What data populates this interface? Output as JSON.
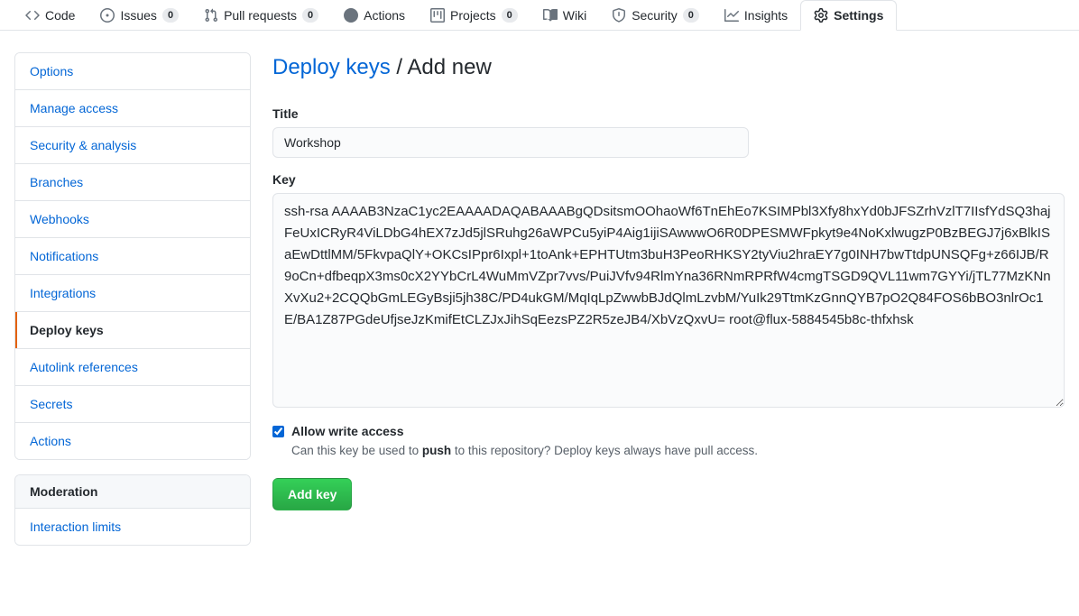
{
  "repo_nav": {
    "tabs": [
      {
        "label": "Code",
        "icon": "code-icon",
        "count": null,
        "selected": false
      },
      {
        "label": "Issues",
        "icon": "issue-opened-icon",
        "count": "0",
        "selected": false
      },
      {
        "label": "Pull requests",
        "icon": "git-pull-request-icon",
        "count": "0",
        "selected": false
      },
      {
        "label": "Actions",
        "icon": "play-icon",
        "count": null,
        "selected": false
      },
      {
        "label": "Projects",
        "icon": "project-icon",
        "count": "0",
        "selected": false
      },
      {
        "label": "Wiki",
        "icon": "book-icon",
        "count": null,
        "selected": false
      },
      {
        "label": "Security",
        "icon": "shield-icon",
        "count": "0",
        "selected": false
      },
      {
        "label": "Insights",
        "icon": "graph-icon",
        "count": null,
        "selected": false
      },
      {
        "label": "Settings",
        "icon": "gear-icon",
        "count": null,
        "selected": true
      }
    ]
  },
  "sidebar": {
    "groups": [
      {
        "heading": null,
        "items": [
          {
            "label": "Options",
            "selected": false
          },
          {
            "label": "Manage access",
            "selected": false
          },
          {
            "label": "Security & analysis",
            "selected": false
          },
          {
            "label": "Branches",
            "selected": false
          },
          {
            "label": "Webhooks",
            "selected": false
          },
          {
            "label": "Notifications",
            "selected": false
          },
          {
            "label": "Integrations",
            "selected": false
          },
          {
            "label": "Deploy keys",
            "selected": true
          },
          {
            "label": "Autolink references",
            "selected": false
          },
          {
            "label": "Secrets",
            "selected": false
          },
          {
            "label": "Actions",
            "selected": false
          }
        ]
      },
      {
        "heading": "Moderation",
        "items": [
          {
            "label": "Interaction limits",
            "selected": false
          }
        ]
      }
    ]
  },
  "main": {
    "breadcrumb_link": "Deploy keys",
    "breadcrumb_separator": " / ",
    "breadcrumb_current": "Add new",
    "title_label": "Title",
    "title_value": "Workshop",
    "title_placeholder": "",
    "key_label": "Key",
    "key_value": "ssh-rsa AAAAB3NzaC1yc2EAAAADAQABAAABgQDsitsmOOhaoWf6TnEhEo7KSIMPbl3Xfy8hxYd0bJFSZrhVzlT7IIsfYdSQ3hajFeUxICRyR4ViLDbG4hEX7zJd5jlSRuhg26aWPCu5yiP4Aig1ijiSAwwwO6R0DPESMWFpkyt9e4NoKxlwugzP0BzBEGJ7j6xBlkISaEwDttlMM/5FkvpaQlY+OKCsIPpr6Ixpl+1toAnk+EPHTUtm3buH3PeoRHKSY2tyViu2hraEY7g0INH7bwTtdpUNSQFg+z66IJB/R9oCn+dfbeqpX3ms0cX2YYbCrL4WuMmVZpr7vvs/PuiJVfv94RlmYna36RNmRPRfW4cmgTSGD9QVL11wm7GYYi/jTL77MzKNnXvXu2+2CQQbGmLEGyBsji5jh38C/PD4ukGM/MqIqLpZwwbBJdQlmLzvbM/YuIk29TtmKzGnnQYB7pO2Q84FOS6bBO3nlrOc1E/BA1Z87PGdeUfjseJzKmifEtCLZJxJihSqEezsPZ2R5zeJB4/XbVzQxvU= root@flux-5884545b8c-thfxhsk",
    "key_placeholder": "",
    "allow_write_label": "Allow write access",
    "allow_write_checked": true,
    "allow_write_note_before": "Can this key be used to ",
    "allow_write_note_bold": "push",
    "allow_write_note_after": " to this repository? Deploy keys always have pull access.",
    "submit_label": "Add key"
  },
  "colors": {
    "link": "#0366d6",
    "accent_selected": "#e36209",
    "button_green": "#28a745",
    "border": "#e1e4e8",
    "muted_text": "#586069"
  }
}
